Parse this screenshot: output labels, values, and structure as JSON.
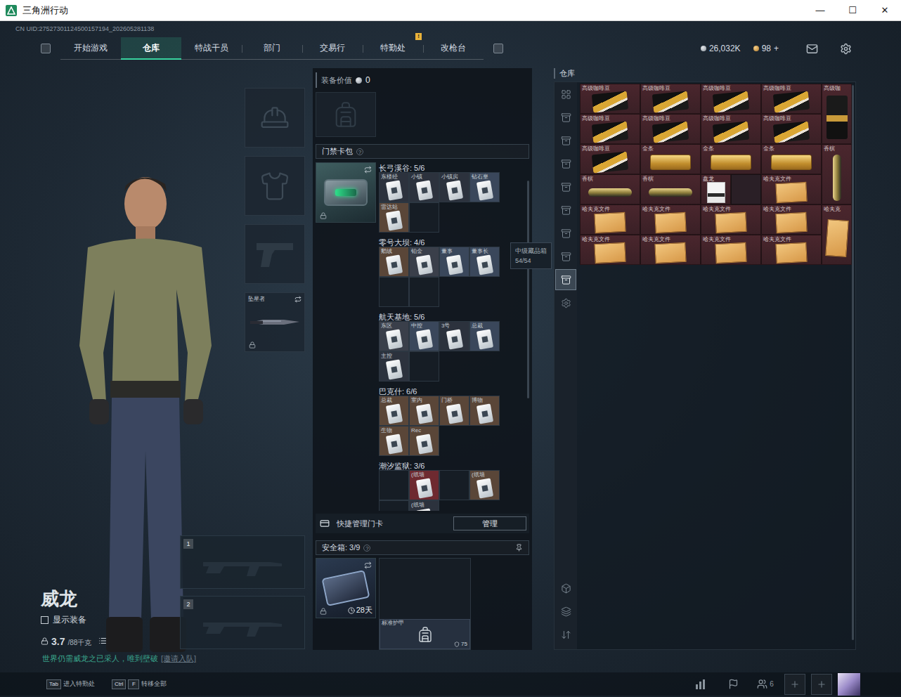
{
  "window": {
    "title": "三角洲行动",
    "controls": [
      "—",
      "☐",
      "✕"
    ]
  },
  "uid": "CN UID:27527301124500157194_202605281138",
  "nav": {
    "tabs": [
      {
        "label": "开始游戏",
        "selected": false
      },
      {
        "label": "仓库",
        "selected": true
      },
      {
        "label": "特战干员",
        "selected": false
      },
      {
        "label": "部门",
        "selected": false
      },
      {
        "label": "交易行",
        "selected": false
      },
      {
        "label": "特勤处",
        "selected": false,
        "badge": "!"
      },
      {
        "label": "改枪台",
        "selected": false
      }
    ]
  },
  "currency": [
    {
      "value": "26,032K"
    },
    {
      "value": "98",
      "action": "+"
    }
  ],
  "operator": {
    "name": "威龙",
    "show_equipment": {
      "label": "显示装备",
      "checked": false
    },
    "weight": "3.7",
    "capacity": "/88千克",
    "motto": "世界仍需威龙之已采人，唯到壁破",
    "invite": "[邀请入队]"
  },
  "equipment": [
    {
      "kind": "helmet",
      "locked": false
    },
    {
      "kind": "armor",
      "locked": false
    },
    {
      "kind": "pistol",
      "locked": false
    },
    {
      "kind": "melee",
      "label": "坠星者",
      "locked": true
    }
  ],
  "weapons": [
    {
      "index": "1"
    },
    {
      "index": "2"
    }
  ],
  "loadout": {
    "label": "装备价值",
    "value": "0"
  },
  "keycards": {
    "title": "门禁卡包",
    "help": "?",
    "case_locked": true,
    "groups": [
      {
        "map": "长弓溪谷: 5/6",
        "slots": [
          {
            "filled": true,
            "label": "东楼经",
            "color": "#2c323d"
          },
          {
            "filled": true,
            "label": "小镇",
            "color": "#2c323d"
          },
          {
            "filled": true,
            "label": "小镇房",
            "color": "#2c323d"
          },
          {
            "filled": true,
            "label": "钻石皇",
            "color": "#3a475b"
          },
          {
            "filled": true,
            "label": "雷达站",
            "color": "#5a4638"
          },
          {
            "filled": false
          }
        ]
      },
      {
        "map": "零号大坝: 4/6",
        "slots": [
          {
            "filled": true,
            "label": "鹅绒",
            "color": "#5a4638"
          },
          {
            "filled": true,
            "label": "铂金",
            "color": "#3a3f4a"
          },
          {
            "filled": true,
            "label": "董事",
            "color": "#3a475b"
          },
          {
            "filled": true,
            "label": "董事长",
            "color": "#3a475b"
          },
          {
            "filled": false
          },
          {
            "filled": false
          }
        ]
      },
      {
        "map": "航天基地: 5/6",
        "slots": [
          {
            "filled": true,
            "label": "东区",
            "color": "#3a3f4a"
          },
          {
            "filled": true,
            "label": "中控",
            "color": "#3a475b"
          },
          {
            "filled": true,
            "label": "3号",
            "color": "#2c323d"
          },
          {
            "filled": true,
            "label": "总裁",
            "color": "#3a475b"
          },
          {
            "filled": true,
            "label": "主控",
            "color": "#2c323d"
          },
          {
            "filled": false
          }
        ]
      },
      {
        "map": "巴克什: 6/6",
        "slots": [
          {
            "filled": true,
            "label": "总裁",
            "color": "#5a4638"
          },
          {
            "filled": true,
            "label": "室内",
            "color": "#5a4638"
          },
          {
            "filled": true,
            "label": "门桥",
            "color": "#5a4638"
          },
          {
            "filled": true,
            "label": "博物",
            "color": "#5a4638"
          },
          {
            "filled": true,
            "label": "生物",
            "color": "#5a4638"
          },
          {
            "filled": true,
            "label": "Rec",
            "color": "#5a4638"
          }
        ]
      },
      {
        "map": "潮汐监狱: 3/6",
        "slots": [
          {
            "filled": false
          },
          {
            "filled": true,
            "label": "(纸墙",
            "color": "#6e2a30"
          },
          {
            "filled": false
          },
          {
            "filled": true,
            "label": "(纸墙",
            "color": "#5a4638"
          },
          {
            "filled": false
          },
          {
            "filled": true,
            "label": "(纸墙",
            "color": "#2c323d"
          }
        ]
      }
    ]
  },
  "quick_manage": {
    "label": "快捷管理门卡",
    "button": "管理"
  },
  "safe_box": {
    "title": "安全箱: 3/9",
    "help": "?",
    "expiry": "28天",
    "locked": true,
    "item": {
      "label": "标准护甲",
      "durability": "75"
    }
  },
  "warehouse": {
    "title": "仓库",
    "sidebar": {
      "top": [
        {
          "kind": "all",
          "selected": false
        },
        {
          "kind": "case",
          "selected": false
        },
        {
          "kind": "case",
          "selected": false
        },
        {
          "kind": "case",
          "selected": false
        },
        {
          "kind": "case",
          "selected": false
        },
        {
          "kind": "case",
          "selected": false
        },
        {
          "kind": "case",
          "selected": false
        },
        {
          "kind": "case",
          "selected": false,
          "tooltip": {
            "title": "中级藏品箱",
            "count": "54/54"
          }
        },
        {
          "kind": "case",
          "selected": true
        },
        {
          "kind": "settings",
          "selected": false
        }
      ],
      "bottom": [
        {
          "kind": "locker",
          "selected": false
        },
        {
          "kind": "layers",
          "selected": false
        },
        {
          "kind": "sort",
          "selected": false
        }
      ]
    },
    "items": [
      {
        "kind": "coffee",
        "label": "高级咖啡豆"
      },
      {
        "kind": "coffee",
        "label": "高级咖啡豆"
      },
      {
        "kind": "coffee",
        "label": "高级咖啡豆"
      },
      {
        "kind": "coffee",
        "label": "高级咖啡豆"
      },
      {
        "kind": "bag",
        "label": "高级咖"
      },
      {
        "kind": "coffee",
        "label": "高级咖啡豆"
      },
      {
        "kind": "coffee",
        "label": "高级咖啡豆"
      },
      {
        "kind": "coffee",
        "label": "高级咖啡豆"
      },
      {
        "kind": "coffee",
        "label": "高级咖啡豆"
      },
      {
        "kind": "coffee",
        "label": "高级咖啡豆"
      },
      {
        "kind": "gold",
        "label": "金条"
      },
      {
        "kind": "gold",
        "label": "金条"
      },
      {
        "kind": "gold",
        "label": "金条"
      },
      {
        "kind": "champagne-upright",
        "label": "香槟"
      },
      {
        "kind": "champagne",
        "label": "香槟"
      },
      {
        "kind": "champagne",
        "label": "香槟"
      },
      {
        "kind": "gift",
        "label": "盘龙"
      },
      {
        "kind": "empty"
      },
      {
        "kind": "file",
        "label": "哈夫克文件"
      },
      {
        "kind": "file",
        "label": "哈夫克文件"
      },
      {
        "kind": "file",
        "label": "哈夫克文件"
      },
      {
        "kind": "file",
        "label": "哈夫克文件"
      },
      {
        "kind": "file",
        "label": "哈夫克文件"
      },
      {
        "kind": "file-upright",
        "label": "哈夫克"
      },
      {
        "kind": "file",
        "label": "哈夫克文件"
      },
      {
        "kind": "file",
        "label": "哈夫克文件"
      },
      {
        "kind": "file",
        "label": "哈夫克文件"
      },
      {
        "kind": "file",
        "label": "哈夫克文件"
      }
    ]
  },
  "footer": {
    "hints": [
      {
        "keys": [
          "Tab"
        ],
        "label": "进入特勤处"
      },
      {
        "keys": [
          "Ctrl",
          "F"
        ],
        "label": "转移全部"
      }
    ],
    "party_count": "6"
  }
}
